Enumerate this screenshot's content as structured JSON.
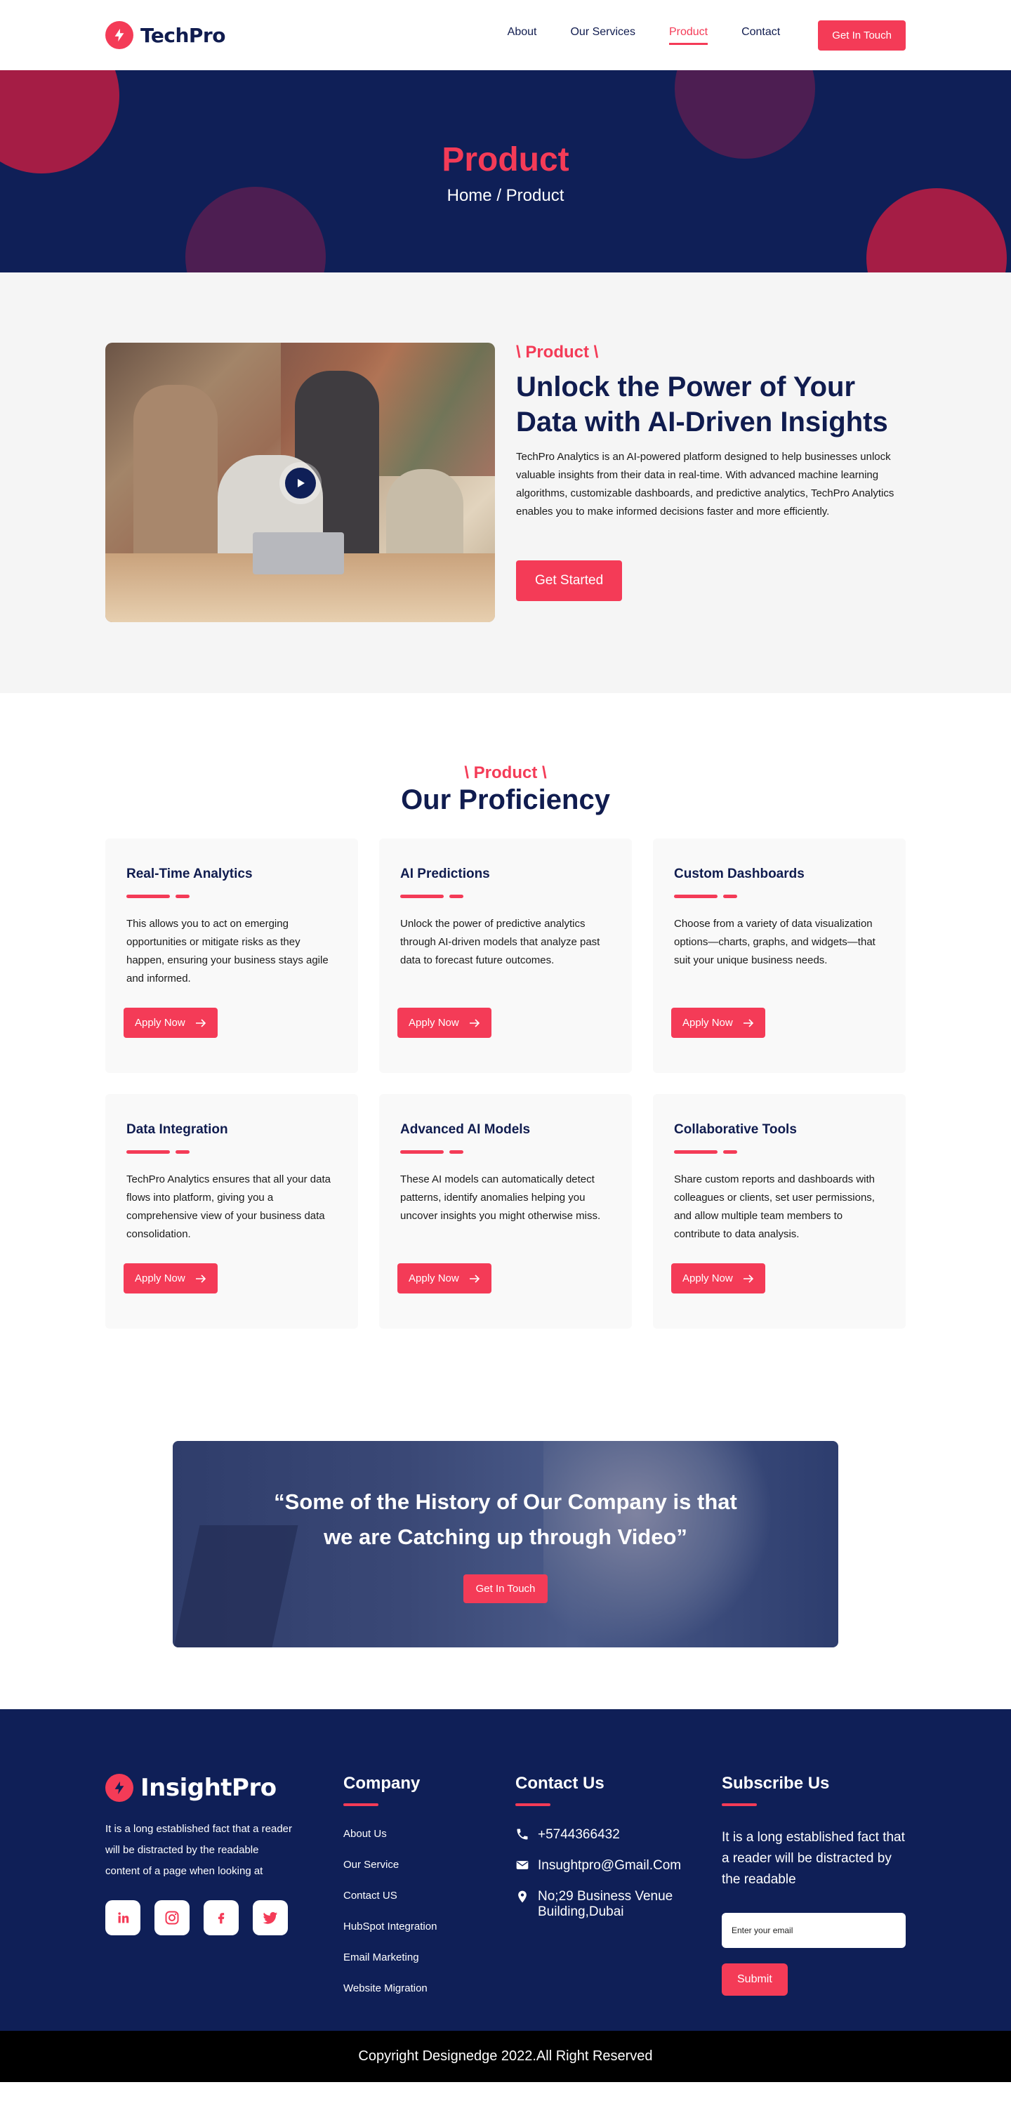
{
  "header": {
    "brand": "TechPro",
    "nav": [
      {
        "label": "About",
        "active": false
      },
      {
        "label": "Our Services",
        "active": false
      },
      {
        "label": "Product",
        "active": true
      },
      {
        "label": "Contact",
        "active": false
      }
    ],
    "cta": "Get In Touch"
  },
  "hero": {
    "title": "Product",
    "breadcrumb": "Home / Product"
  },
  "intro": {
    "eyebrow": "\\ Product \\",
    "title": "Unlock the Power of Your Data with AI-Driven Insights",
    "body": "TechPro Analytics is an AI-powered platform designed to help businesses unlock valuable insights from their data in real-time. With advanced machine learning algorithms, customizable dashboards, and predictive analytics, TechPro Analytics enables you to make informed decisions faster and more efficiently.",
    "cta": "Get Started"
  },
  "proficiency": {
    "eyebrow": "\\ Product \\",
    "title": "Our Proficiency",
    "cards": [
      {
        "title": "Real-Time Analytics",
        "desc": "This allows you to act on emerging opportunities or mitigate risks as they happen, ensuring your business stays agile and informed.",
        "button": "Apply Now"
      },
      {
        "title": "AI Predictions",
        "desc": "Unlock the power of predictive analytics through AI-driven models that analyze past data to forecast future outcomes.",
        "button": "Apply Now"
      },
      {
        "title": "Custom Dashboards",
        "desc": "Choose from a variety of data visualization options—charts, graphs, and widgets—that suit your unique business needs.",
        "button": "Apply Now"
      },
      {
        "title": "Data Integration",
        "desc": "TechPro Analytics ensures that all your data flows into platform, giving you a comprehensive view of your business data consolidation.",
        "button": "Apply Now"
      },
      {
        "title": "Advanced AI Models",
        "desc": "These AI models can automatically detect patterns, identify anomalies helping you uncover insights you might otherwise miss.",
        "button": "Apply Now"
      },
      {
        "title": "Collaborative Tools",
        "desc": "Share custom reports and dashboards with colleagues or clients, set user permissions, and allow multiple team members to contribute to data analysis.",
        "button": "Apply Now"
      }
    ]
  },
  "banner": {
    "quote_line1": "“Some of the History of Our Company is that",
    "quote_line2": "we are Catching up through Video”",
    "cta": "Get In Touch"
  },
  "footer": {
    "brand": "InsightPro",
    "about": "It is a long established fact that a reader will be distracted by the readable content of a page when looking at",
    "socials": [
      "linkedin-icon",
      "instagram-icon",
      "facebook-icon",
      "twitter-icon"
    ],
    "company": {
      "title": "Company",
      "links": [
        "About Us",
        "Our Service",
        "Contact US",
        "HubSpot Integration",
        "Email Marketing",
        "Website Migration"
      ]
    },
    "contact": {
      "title": "Contact Us",
      "phone": "+5744366432",
      "email": "Insughtpro@Gmail.Com",
      "address": "No;29 Business Venue Building,Dubai"
    },
    "subscribe": {
      "title": "Subscribe Us",
      "text": "It is a long established fact that a reader will be distracted by the readable",
      "placeholder": "Enter your email",
      "button": "Submit"
    }
  },
  "copyright": "Copyright Designedge 2022.All Right Reserved",
  "colors": {
    "accent": "#f43b57",
    "navy": "#0f1f57",
    "dark_text": "#101c4f"
  }
}
